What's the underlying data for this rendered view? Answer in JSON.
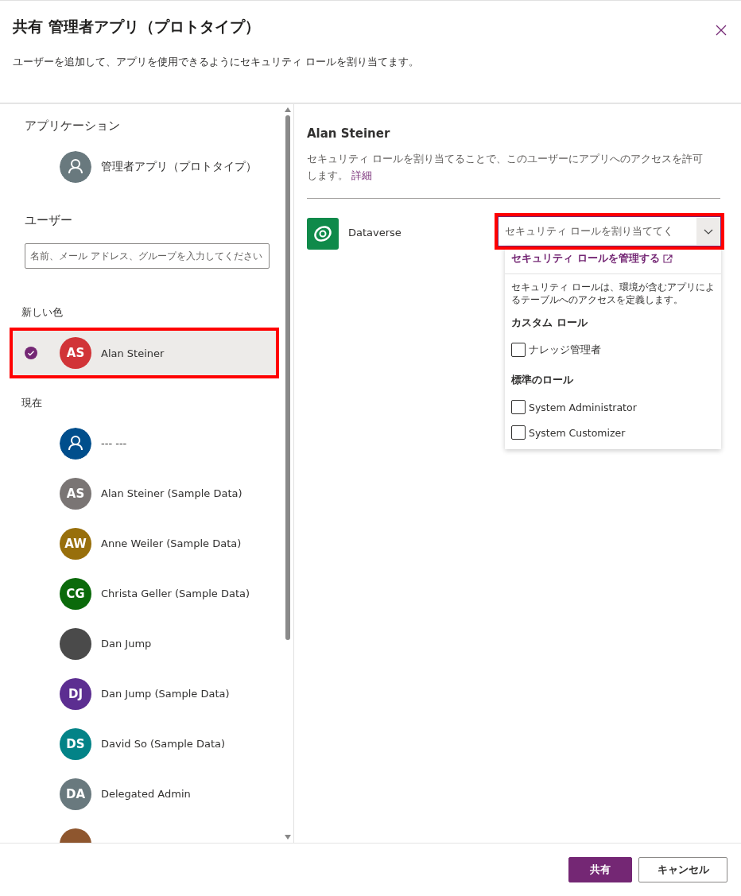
{
  "dialog": {
    "title": "共有 管理者アプリ（プロトタイプ）",
    "subtitle": "ユーザーを追加して、アプリを使用できるようにセキュリティ ロールを割り当てます。"
  },
  "left": {
    "app_heading": "アプリケーション",
    "app_name": "管理者アプリ（プロトタイプ）",
    "users_heading": "ユーザー",
    "search": {
      "placeholder": "名前、メール アドレス、グループを入力してください"
    },
    "new_heading": "新しい色",
    "new_users": [
      {
        "initials": "AS",
        "name": "Alan Steiner",
        "color": "#d13438",
        "selected": true,
        "highlighted": true
      }
    ],
    "current_heading": "現在",
    "current_users": [
      {
        "name": "--- ---",
        "color": "#004e8c",
        "kind": "icon"
      },
      {
        "initials": "AS",
        "name": "Alan Steiner (Sample Data)",
        "color": "#7a7574",
        "kind": "initials"
      },
      {
        "initials": "AW",
        "name": "Anne Weiler (Sample Data)",
        "color": "#986f0b",
        "kind": "initials"
      },
      {
        "initials": "CG",
        "name": "Christa Geller (Sample Data)",
        "color": "#0b6a0b",
        "kind": "initials"
      },
      {
        "name": "Dan Jump",
        "kind": "photo"
      },
      {
        "initials": "DJ",
        "name": "Dan Jump (Sample Data)",
        "color": "#5c2e91",
        "kind": "initials"
      },
      {
        "initials": "DS",
        "name": "David So (Sample Data)",
        "color": "#038387",
        "kind": "initials"
      },
      {
        "initials": "DA",
        "name": "Delegated Admin",
        "color": "#69797e",
        "kind": "initials"
      },
      {
        "color": "#8e562e",
        "kind": "partial"
      }
    ]
  },
  "right": {
    "user_name": "Alan Steiner",
    "description": "セキュリティ ロールを割り当てることで、このユーザーにアプリへのアクセスを許可します。",
    "details_link": "詳細",
    "env_name": "Dataverse",
    "role_select": {
      "placeholder": "セキュリティ ロールを割り当ててく",
      "highlighted": true
    },
    "dropdown": {
      "manage_link": "セキュリティ ロールを管理する",
      "note": "セキュリティ ロールは、環境が含むアプリによるテーブルへのアクセスを定義します。",
      "groups": [
        {
          "heading": "カスタム ロール",
          "roles": [
            {
              "label": "ナレッジ管理者",
              "checked": false
            }
          ]
        },
        {
          "heading": "標準のロール",
          "roles": [
            {
              "label": "System Administrator",
              "checked": false
            },
            {
              "label": "System Customizer",
              "checked": false
            }
          ]
        }
      ]
    }
  },
  "buttons": [
    {
      "label": "共有",
      "kind": "primary"
    },
    {
      "label": "キャンセル",
      "kind": "secondary"
    }
  ]
}
